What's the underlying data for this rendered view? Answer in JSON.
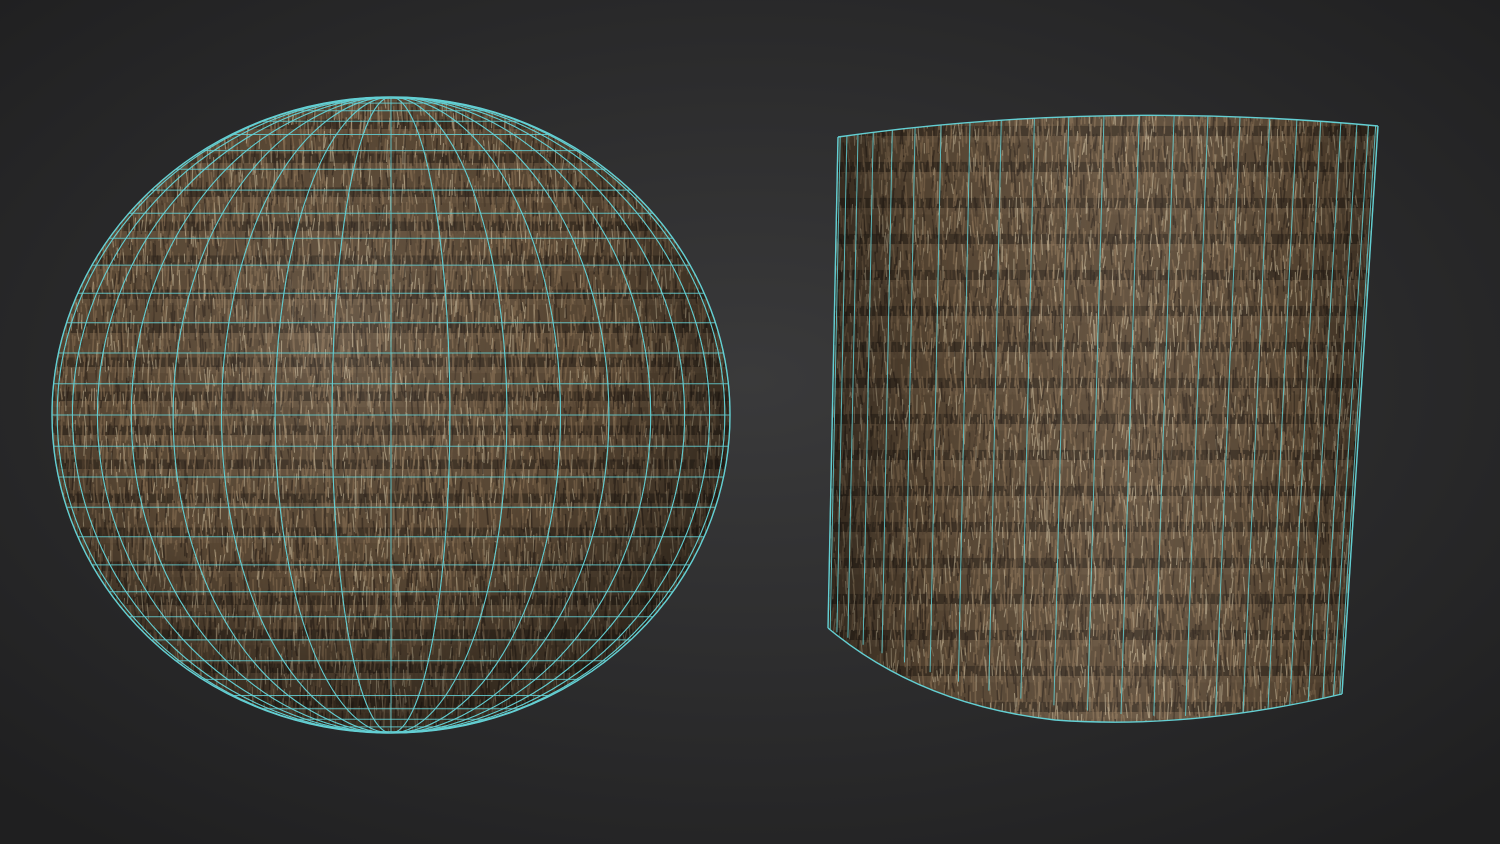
{
  "scene": {
    "background": {
      "center": "#3a3a3b",
      "edge": "#1f1f20"
    },
    "wireframe_color": "#63cfd3",
    "thatch_colors": {
      "dark": "#2b2219",
      "mid": "#5c4a36",
      "light": "#8d7456",
      "highlight": "#d8c8a6"
    },
    "objects": [
      {
        "name": "thatch-sphere",
        "shape": "sphere",
        "material": "thatch",
        "wireframe": true
      },
      {
        "name": "thatch-cylinder",
        "shape": "cylinder",
        "material": "thatch",
        "wireframe": true
      }
    ]
  }
}
